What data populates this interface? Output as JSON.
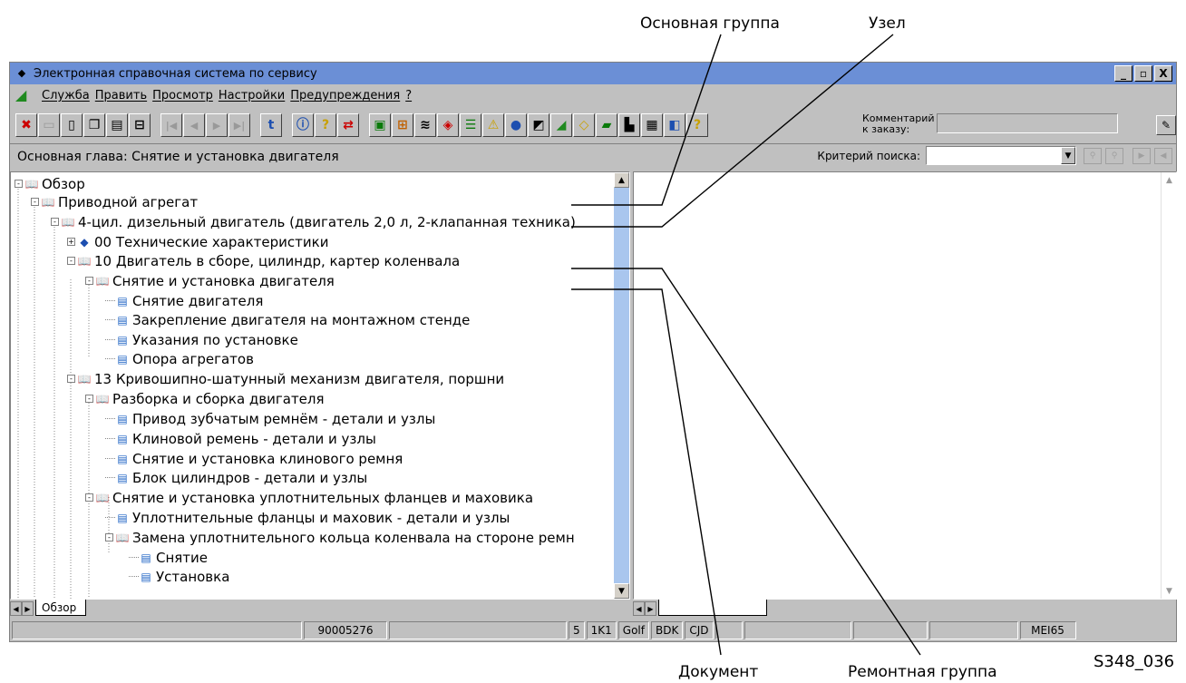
{
  "callouts": {
    "main_group": "Основная группа",
    "node": "Узел",
    "document": "Документ",
    "repair_group": "Ремонтная группа"
  },
  "figure_ref": "S348_036",
  "window": {
    "title": "Электронная справочная система по сервису",
    "controls": [
      "_",
      "▫",
      "X"
    ]
  },
  "menu": [
    "Служба",
    "Править",
    "Просмотр",
    "Настройки",
    "Предупреждения",
    "?"
  ],
  "toolbar": {
    "comment_label": "Комментарий к заказу:",
    "comment_value": ""
  },
  "chapter_bar": {
    "chapter": "Основная глава: Снятие и установка двигателя",
    "search_label": "Критерий поиска:",
    "search_value": ""
  },
  "tree": [
    {
      "label": "Обзор",
      "icon": "book",
      "pm": "-"
    },
    {
      "label": "Приводной агрегат",
      "icon": "book",
      "pm": "-"
    },
    {
      "label": "4-цил. дизельный двигатель (двигатель 2,0 л, 2-клапанная техника)",
      "icon": "book",
      "pm": "-"
    },
    {
      "label": "00 Технические характеристики",
      "icon": "blue",
      "pm": "+"
    },
    {
      "label": "10 Двигатель в сборе, цилиндр, картер коленвала",
      "icon": "book",
      "pm": "-"
    },
    {
      "label": "Снятие и установка двигателя",
      "icon": "book",
      "pm": "-"
    },
    {
      "label": "Снятие двигателя",
      "icon": "doc",
      "pm": ""
    },
    {
      "label": "Закрепление двигателя на монтажном стенде",
      "icon": "doc",
      "pm": ""
    },
    {
      "label": "Указания по установке",
      "icon": "doc",
      "pm": ""
    },
    {
      "label": "Опора агрегатов",
      "icon": "doc",
      "pm": ""
    },
    {
      "label": "13 Кривошипно-шатунный механизм двигателя, поршни",
      "icon": "book",
      "pm": "-"
    },
    {
      "label": "Разборка и сборка двигателя",
      "icon": "book",
      "pm": "-"
    },
    {
      "label": "Привод зубчатым ремнём - детали и узлы",
      "icon": "doc",
      "pm": ""
    },
    {
      "label": "Клиновой ремень - детали и узлы",
      "icon": "doc",
      "pm": ""
    },
    {
      "label": "Снятие и установка клинового ремня",
      "icon": "doc",
      "pm": ""
    },
    {
      "label": "Блок цилиндров - детали и узлы",
      "icon": "doc",
      "pm": ""
    },
    {
      "label": "Снятие и установка уплотнительных фланцев и маховика",
      "icon": "book",
      "pm": "-"
    },
    {
      "label": "Уплотнительные фланцы и маховик - детали и узлы",
      "icon": "doc",
      "pm": ""
    },
    {
      "label": "Замена уплотнительного кольца коленвала на стороне ремн",
      "icon": "book",
      "pm": "-"
    },
    {
      "label": "Снятие",
      "icon": "doc",
      "pm": ""
    },
    {
      "label": "Установка",
      "icon": "doc",
      "pm": ""
    }
  ],
  "left_tab": "Обзор",
  "status": {
    "order": "90005276",
    "fields": [
      "5",
      "1K1",
      "Golf",
      "BDK",
      "CJD"
    ],
    "user": "MEI65"
  }
}
